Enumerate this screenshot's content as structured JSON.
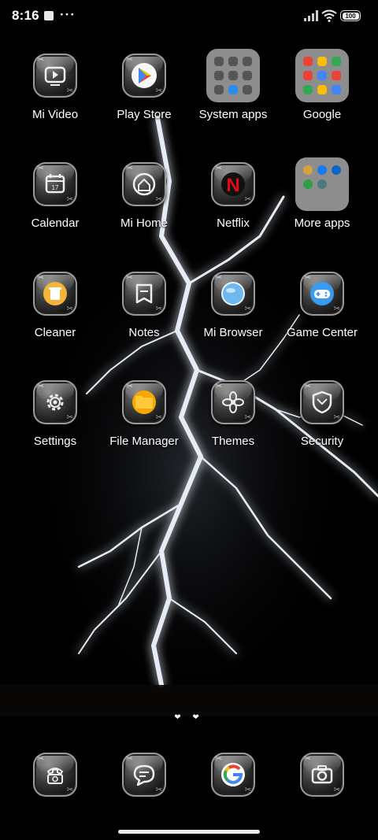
{
  "status_bar": {
    "time": "8:16",
    "overflow": "···",
    "battery": "100"
  },
  "apps": [
    {
      "label": "Mi Video",
      "icon": "mi-video-icon"
    },
    {
      "label": "Play Store",
      "icon": "play-store-icon"
    },
    {
      "label": "System apps",
      "icon": "folder-icon"
    },
    {
      "label": "Google",
      "icon": "folder-icon"
    },
    {
      "label": "Calendar",
      "icon": "calendar-icon"
    },
    {
      "label": "Mi Home",
      "icon": "mi-home-icon"
    },
    {
      "label": "Netflix",
      "icon": "netflix-icon"
    },
    {
      "label": "More apps",
      "icon": "folder-icon"
    },
    {
      "label": "Cleaner",
      "icon": "cleaner-icon"
    },
    {
      "label": "Notes",
      "icon": "notes-icon"
    },
    {
      "label": "Mi Browser",
      "icon": "browser-icon"
    },
    {
      "label": "Game Center",
      "icon": "game-center-icon"
    },
    {
      "label": "Settings",
      "icon": "gear-icon"
    },
    {
      "label": "File Manager",
      "icon": "file-manager-icon"
    },
    {
      "label": "Themes",
      "icon": "themes-icon"
    },
    {
      "label": "Security",
      "icon": "security-icon"
    }
  ],
  "calendar_day": "17",
  "netflix_letter": "N",
  "pager": "❤ ❤",
  "dock": [
    {
      "name": "phone",
      "icon": "phone-icon"
    },
    {
      "name": "messages",
      "icon": "messages-icon"
    },
    {
      "name": "chrome",
      "icon": "google-icon"
    },
    {
      "name": "camera",
      "icon": "camera-icon"
    }
  ],
  "colors": {
    "background": "#000000",
    "text": "#ffffff",
    "folder": "#8d8d8d",
    "netflix": "#e50914",
    "cleaner": "#f5b43a"
  }
}
